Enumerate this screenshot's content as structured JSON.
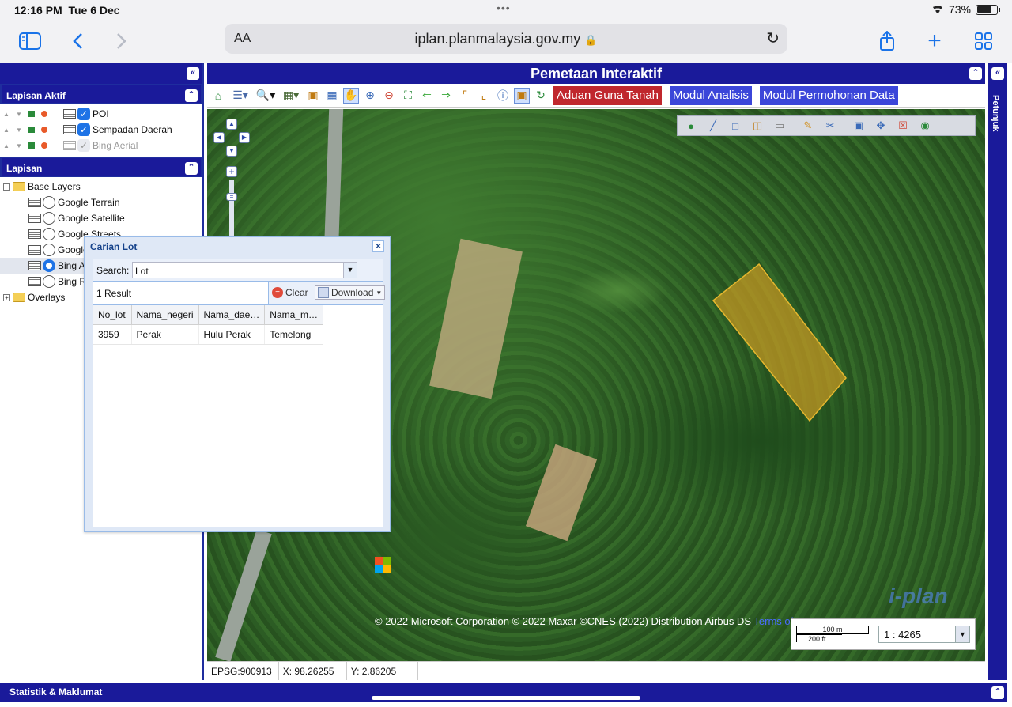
{
  "status": {
    "time": "12:16 PM",
    "date": "Tue 6 Dec",
    "battery": "73%"
  },
  "browser": {
    "aa": "AA",
    "url": "iplan.planmalaysia.gov.my"
  },
  "left": {
    "active_title": "Lapisan Aktif",
    "active_layers": [
      "POI",
      "Sempadan Daerah",
      "Bing Aerial"
    ],
    "layers_title": "Lapisan",
    "base_layers": "Base Layers",
    "base_items": [
      "Google Terrain",
      "Google Satellite",
      "Google Streets",
      "Google Hybrid",
      "Bing Aerial",
      "Bing Road"
    ],
    "overlays": "Overlays"
  },
  "map": {
    "title": "Pemetaan Interaktif",
    "buttons": {
      "aduan": "Aduan Guna Tanah",
      "analisis": "Modul Analisis",
      "permohonan": "Modul Permohonan Data"
    },
    "copyright": "© 2022 Microsoft Corporation © 2022 Maxar ©CNES (2022) Distribution Airbus DS",
    "terms": "Terms of Use",
    "scale_m": "100 m",
    "scale_ft": "200 ft",
    "scale": "1 : 4265",
    "watermark": "i-plan",
    "epsg": "EPSG:900913",
    "x": "X: 98.26255",
    "y": "Y: 2.86205"
  },
  "right_rail": "Petunjuk",
  "bottom": "Statistik & Maklumat",
  "dialog": {
    "title": "Carian Lot",
    "search_label": "Search:",
    "search_value": "Lot",
    "result": "1 Result",
    "clear": "Clear",
    "download": "Download",
    "columns": [
      "No_lot",
      "Nama_negeri",
      "Nama_dae…",
      "Nama_m…"
    ],
    "rows": [
      [
        "3959",
        "Perak",
        "Hulu Perak",
        "Temelong"
      ]
    ]
  },
  "colors": {
    "nav_blue": "#1a1a9a",
    "aduan_red": "#c0272d",
    "module_blue": "#3b46d9",
    "lot_fill": "#c99a22"
  }
}
